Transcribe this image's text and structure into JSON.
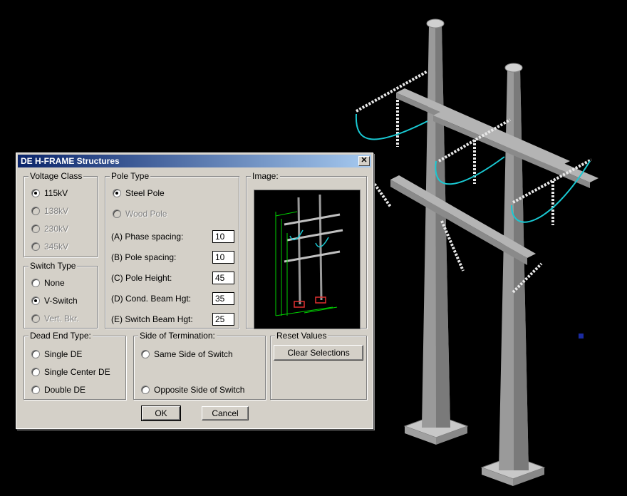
{
  "dialog": {
    "title": "DE H-FRAME Structures",
    "close_glyph": "✕",
    "voltage_class": {
      "legend": "Voltage Class",
      "options": [
        {
          "label": "115kV",
          "checked": true,
          "enabled": true
        },
        {
          "label": "138kV",
          "checked": false,
          "enabled": false
        },
        {
          "label": "230kV",
          "checked": false,
          "enabled": false
        },
        {
          "label": "345kV",
          "checked": false,
          "enabled": false
        }
      ]
    },
    "switch_type": {
      "legend": "Switch Type",
      "options": [
        {
          "label": "None",
          "checked": false,
          "enabled": true
        },
        {
          "label": "V-Switch",
          "checked": true,
          "enabled": true
        },
        {
          "label": "Vert. Bkr.",
          "checked": false,
          "enabled": false
        }
      ]
    },
    "pole_type": {
      "legend": "Pole Type",
      "options": [
        {
          "label": "Steel Pole",
          "checked": true,
          "enabled": true
        },
        {
          "label": "Wood Pole",
          "checked": false,
          "enabled": false
        }
      ],
      "fields": [
        {
          "label": "(A) Phase spacing:",
          "value": "10"
        },
        {
          "label": "(B) Pole spacing:",
          "value": "10"
        },
        {
          "label": "(C) Pole Height:",
          "value": "45"
        },
        {
          "label": "(D) Cond. Beam Hgt:",
          "value": "35"
        },
        {
          "label": "(E) Switch Beam Hgt:",
          "value": "25"
        }
      ]
    },
    "image": {
      "legend": "Image:"
    },
    "dead_end_type": {
      "legend": "Dead End Type:",
      "options": [
        {
          "label": "Single DE",
          "checked": false,
          "enabled": true
        },
        {
          "label": "Single Center DE",
          "checked": false,
          "enabled": true
        },
        {
          "label": "Double DE",
          "checked": false,
          "enabled": true
        }
      ]
    },
    "side_of_termination": {
      "legend": "Side of Termination:",
      "options": [
        {
          "label": "Same Side of Switch",
          "checked": false,
          "enabled": true
        },
        {
          "label": "Opposite Side of Switch",
          "checked": false,
          "enabled": true
        }
      ]
    },
    "reset_values": {
      "legend": "Reset Values",
      "clear_button": "Clear Selections"
    },
    "ok_button": "OK",
    "cancel_button": "Cancel"
  },
  "colors": {
    "dialog_bg": "#d4d0c8",
    "title_start": "#0a246a",
    "title_end": "#a6caf0",
    "insulator_cyan": "#19c8d2",
    "pole_grey": "#8e8e8e",
    "preview_green": "#00d000"
  }
}
